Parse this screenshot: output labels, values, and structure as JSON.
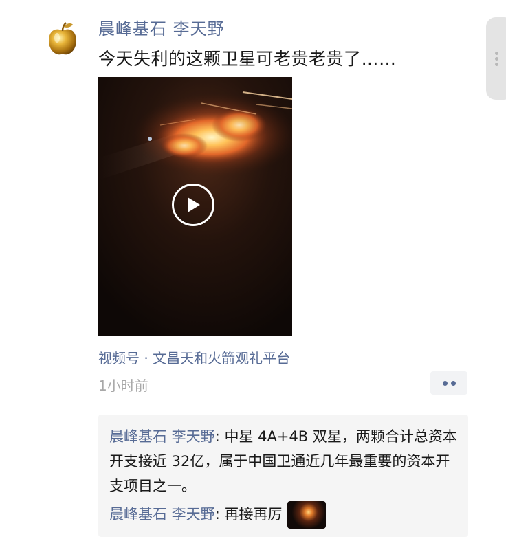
{
  "post": {
    "author": "晨峰基石 李天野",
    "text": "今天失利的这颗卫星可老贵老贵了……",
    "video": {
      "icon": "play-icon"
    },
    "source": "视频号 · 文昌天和火箭观礼平台",
    "time": "1小时前"
  },
  "comments": [
    {
      "name": "晨峰基石 李天野",
      "separator": ": ",
      "text": "中星 4A+4B 双星，两颗合计总资本开支接近 32亿，属于中国卫通近几年最重要的资本开支项目之一。"
    },
    {
      "name": "晨峰基石 李天野",
      "separator": ": ",
      "text": "再接再厉"
    }
  ],
  "colors": {
    "link": "#576b95",
    "text": "#191919",
    "meta": "#a8a8a8",
    "comment_bg": "#f5f5f5"
  }
}
